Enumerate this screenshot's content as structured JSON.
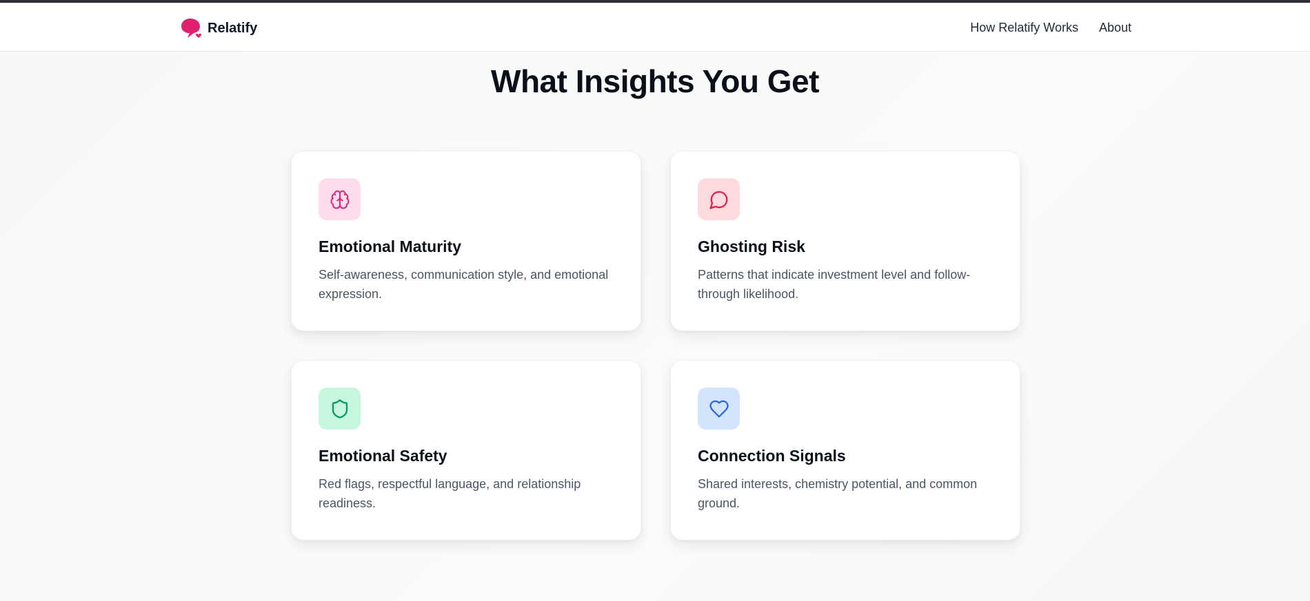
{
  "header": {
    "brand": "Relatify",
    "nav": [
      "How Relatify Works",
      "About"
    ]
  },
  "section": {
    "title": "What Insights You Get"
  },
  "cards": [
    {
      "title": "Emotional Maturity",
      "description": "Self-awareness, communication style, and emotional expression.",
      "icon": "brain-icon",
      "icon_bg": "#fdddec",
      "icon_color": "#db2777"
    },
    {
      "title": "Ghosting Risk",
      "description": "Patterns that indicate investment level and follow-through likelihood.",
      "icon": "chat-bubble-icon",
      "icon_bg": "#fedadf",
      "icon_color": "#e11d48"
    },
    {
      "title": "Emotional Safety",
      "description": "Red flags, respectful language, and relationship readiness.",
      "icon": "shield-icon",
      "icon_bg": "#c6f6db",
      "icon_color": "#059669"
    },
    {
      "title": "Connection Signals",
      "description": "Shared interests, chemistry potential, and common ground.",
      "icon": "heart-icon",
      "icon_bg": "#d3e4fe",
      "icon_color": "#2563eb"
    }
  ],
  "colors": {
    "brand": "#e0206f",
    "heading": "#0b0f19",
    "body_text": "#4b5563"
  }
}
